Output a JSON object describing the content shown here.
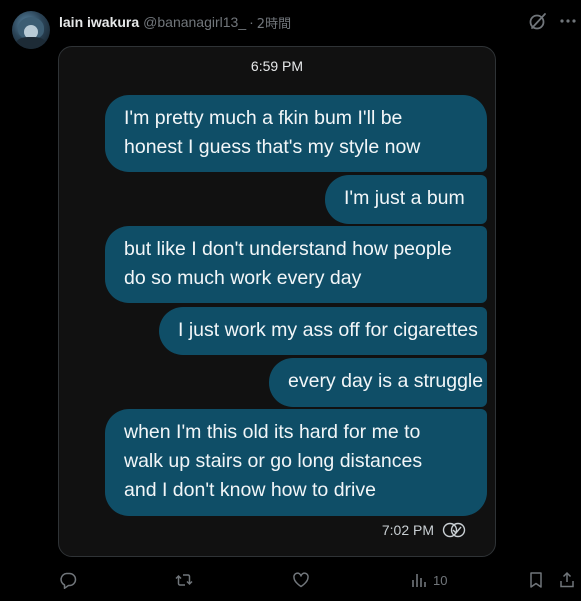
{
  "post": {
    "author_name": "lain iwakura",
    "author_handle": "@bananagirl13_",
    "separator": "·",
    "timestamp": "2時間"
  },
  "media": {
    "chat_time": "6:59 PM",
    "messages": [
      {
        "lines": [
          "I'm pretty much a fkin bum I'll be",
          "honest I guess that's my style now"
        ]
      },
      {
        "lines": [
          "I'm just a bum"
        ]
      },
      {
        "lines": [
          "but like I don't understand how people",
          "do so much work every day"
        ]
      },
      {
        "lines": [
          "I just work my ass off for cigarettes"
        ]
      },
      {
        "lines": [
          "every day is a struggle"
        ]
      },
      {
        "lines": [
          "when I'm this old its hard for me to",
          "walk up stairs or go long distances",
          "and I don't know how to drive"
        ]
      }
    ],
    "last_time": "7:02 PM",
    "bubble_color": "#0f4e67"
  },
  "actions": {
    "views_count": "10"
  },
  "icons": {
    "grok": "grok-icon",
    "more": "more-icon",
    "reply": "reply-icon",
    "repost": "repost-icon",
    "like": "like-icon",
    "views": "views-icon",
    "bookmark": "bookmark-icon",
    "share": "share-icon",
    "read": "read-receipt-icon"
  }
}
